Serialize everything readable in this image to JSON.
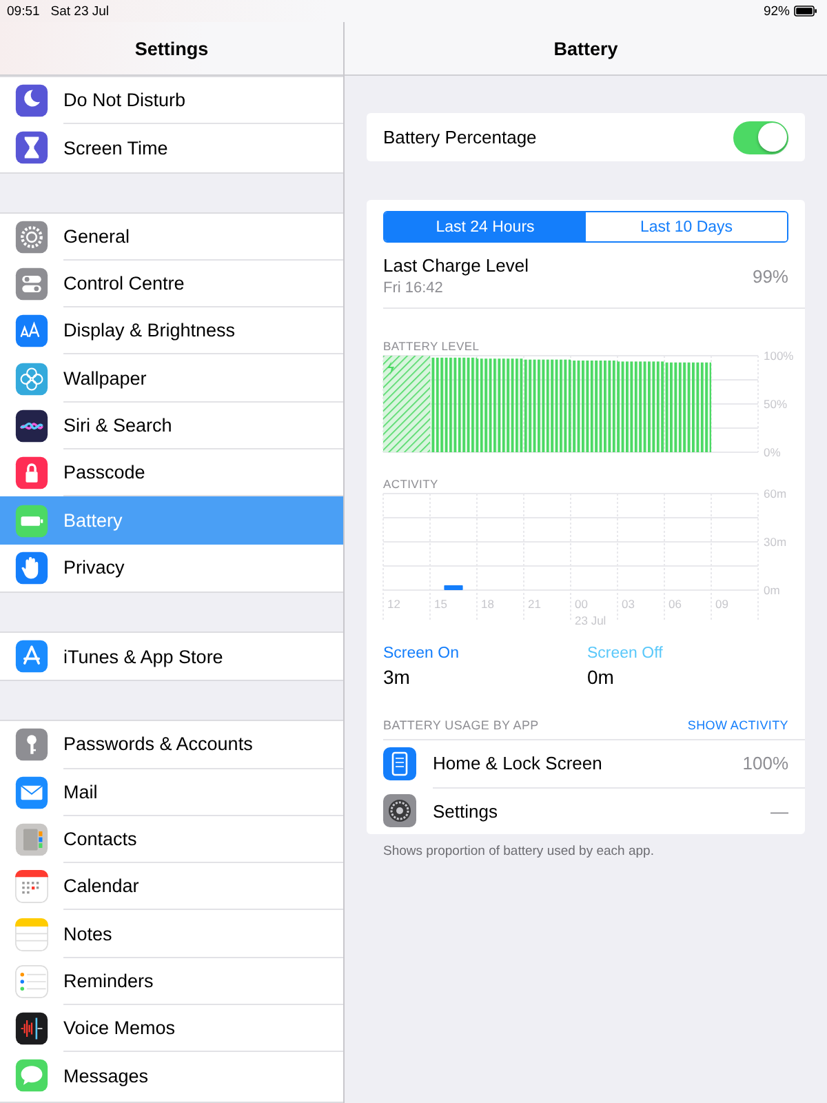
{
  "status_bar": {
    "time": "09:51",
    "date": "Sat 23 Jul",
    "battery": "92%"
  },
  "sidebar": {
    "title": "Settings",
    "groups": [
      {
        "items": [
          {
            "label": "Do Not Disturb",
            "color": "#5856d6",
            "selected": false
          },
          {
            "label": "Screen Time",
            "color": "#5856d6",
            "selected": false
          }
        ]
      },
      {
        "items": [
          {
            "label": "General",
            "color": "#8e8e93",
            "selected": false
          },
          {
            "label": "Control Centre",
            "color": "#8e8e93",
            "selected": false
          },
          {
            "label": "Display & Brightness",
            "color": "#147efb",
            "selected": false
          },
          {
            "label": "Wallpaper",
            "color": "#34aadc",
            "selected": false
          },
          {
            "label": "Siri & Search",
            "color": "#23234a",
            "selected": false
          },
          {
            "label": "Passcode",
            "color": "#ff2d55",
            "selected": false
          },
          {
            "label": "Battery",
            "color": "#4cd964",
            "selected": true
          },
          {
            "label": "Privacy",
            "color": "#147efb",
            "selected": false
          }
        ]
      },
      {
        "items": [
          {
            "label": "iTunes & App Store",
            "color": "#1a8cff",
            "selected": false
          }
        ]
      },
      {
        "items": [
          {
            "label": "Passwords & Accounts",
            "color": "#8e8e93",
            "selected": false
          },
          {
            "label": "Mail",
            "color": "#1a8cff",
            "selected": false
          },
          {
            "label": "Contacts",
            "color": "#c8c6c4",
            "selected": false
          },
          {
            "label": "Calendar",
            "selected": false
          },
          {
            "label": "Notes",
            "selected": false
          },
          {
            "label": "Reminders",
            "selected": false
          },
          {
            "label": "Voice Memos",
            "color": "#1c1c1e",
            "selected": false
          },
          {
            "label": "Messages",
            "color": "#4cd964",
            "selected": false
          }
        ]
      }
    ]
  },
  "detail": {
    "title": "Battery",
    "battery_percentage": {
      "label": "Battery Percentage",
      "on": true
    },
    "segments": [
      {
        "label": "Last 24 Hours",
        "selected": true
      },
      {
        "label": "Last 10 Days",
        "selected": false
      }
    ],
    "last_charge": {
      "label": "Last Charge Level",
      "time": "Fri 16:42",
      "value": "99%"
    },
    "battery_level": {
      "chart_data": {
        "type": "bar",
        "title": "BATTERY LEVEL",
        "series": [
          {
            "color": "#4cd964",
            "values": [
              100,
              null,
              null,
              null,
              null,
              null,
              null,
              null
            ]
          },
          {
            "color": "#4cd964",
            "values": [
              null,
              98,
              97,
              96,
              95,
              94,
              93,
              null
            ]
          }
        ],
        "ylim": [
          0,
          100
        ],
        "yticks": [
          {
            "value": 100,
            "label": "100%"
          },
          {
            "value": 50,
            "label": "50%"
          },
          {
            "value": 0,
            "label": "0%"
          }
        ]
      }
    },
    "activity": {
      "chart_data": {
        "type": "bar",
        "title": "ACTIVITY",
        "categories": [
          "12",
          "15",
          "18",
          "21",
          "00",
          "03",
          "06",
          "09"
        ],
        "series": [
          {
            "color": "#147efb",
            "values": [
              0,
              3,
              0,
              0,
              0,
              0,
              0,
              0
            ]
          }
        ],
        "ylim": [
          0,
          60
        ],
        "yticks": [
          {
            "value": 60,
            "label": "60m"
          },
          {
            "value": 30,
            "label": "30m"
          },
          {
            "value": 0,
            "label": "0m"
          }
        ],
        "annotations": [
          "23 Jul"
        ]
      }
    },
    "screen_stats": [
      {
        "label": "Screen On",
        "value": "3m",
        "color": "#147efb"
      },
      {
        "label": "Screen Off",
        "value": "0m",
        "color": "#5ac8fa"
      }
    ],
    "usage": {
      "title": "BATTERY USAGE BY APP",
      "action": "SHOW ACTIVITY",
      "apps": [
        {
          "name": "Home & Lock Screen",
          "value": "100%",
          "color": "#147efb"
        },
        {
          "name": "Settings",
          "value": "—",
          "color": "#8e8e93"
        }
      ]
    },
    "footnote": "Shows proportion of battery used by each app."
  }
}
